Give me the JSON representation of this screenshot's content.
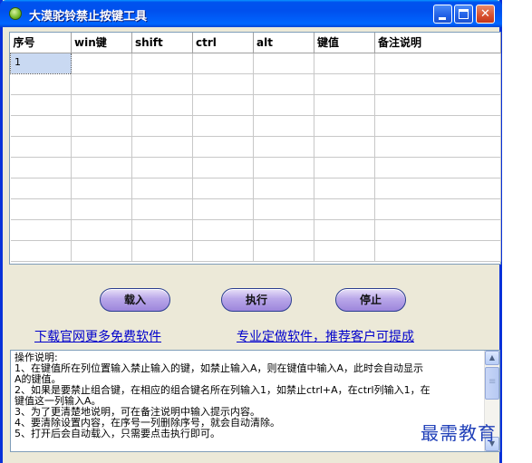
{
  "window": {
    "title": "大漠驼铃禁止按键工具",
    "controls": {
      "minimize": "_",
      "maximize": "□",
      "close": "✕"
    }
  },
  "grid": {
    "columns": [
      "序号",
      "win键",
      "shift",
      "ctrl",
      "alt",
      "键值",
      "备注说明"
    ],
    "rows": [
      [
        "1",
        "",
        "",
        "",
        "",
        "",
        ""
      ],
      [
        "",
        "",
        "",
        "",
        "",
        "",
        ""
      ],
      [
        "",
        "",
        "",
        "",
        "",
        "",
        ""
      ],
      [
        "",
        "",
        "",
        "",
        "",
        "",
        ""
      ],
      [
        "",
        "",
        "",
        "",
        "",
        "",
        ""
      ],
      [
        "",
        "",
        "",
        "",
        "",
        "",
        ""
      ],
      [
        "",
        "",
        "",
        "",
        "",
        "",
        ""
      ],
      [
        "",
        "",
        "",
        "",
        "",
        "",
        ""
      ],
      [
        "",
        "",
        "",
        "",
        "",
        "",
        ""
      ],
      [
        "",
        "",
        "",
        "",
        "",
        "",
        ""
      ]
    ]
  },
  "buttons": {
    "load": "载入",
    "run": "执行",
    "stop": "停止"
  },
  "links": {
    "download": "下载官网更多免费软件",
    "custom": "专业定做软件，推荐客户可提成"
  },
  "instructions": {
    "lines": [
      "操作说明:",
      "1、在键值所在列位置输入禁止输入的键，如禁止输入A，则在键值中输入A，此时会自动显示",
      "A的键值。",
      "2、如果是要禁止组合键，在相应的组合键名所在列输入1，如禁止ctrl+A，在ctrl列输入1，在",
      "键值这一列输入A。",
      "3、为了更清楚地说明，可在备注说明中输入提示内容。",
      "4、要清除设置内容，在序号一列删除序号，就会自动清除。",
      "5、打开后会自动载入，只需要点击执行即可。"
    ]
  },
  "watermark": "最需教育"
}
